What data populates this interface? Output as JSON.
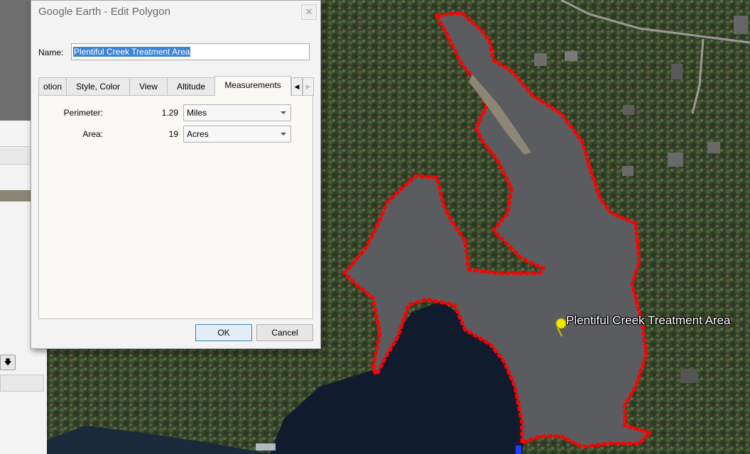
{
  "dialog": {
    "title": "Google Earth - Edit Polygon",
    "close_glyph": "✕",
    "name_label": "Name:",
    "name_value": "Plentiful Creek Treatment Area",
    "tabs": [
      {
        "label": "otion"
      },
      {
        "label": "Style, Color"
      },
      {
        "label": "View"
      },
      {
        "label": "Altitude"
      },
      {
        "label": "Measurements",
        "active": true
      }
    ],
    "tab_scroll_left": "◀",
    "tab_scroll_right": "▶",
    "measurements": {
      "perimeter_label": "Perimeter:",
      "perimeter_value": "1.29",
      "perimeter_unit": "Miles",
      "area_label": "Area:",
      "area_value": "19",
      "area_unit": "Acres"
    },
    "ok_label": "OK",
    "cancel_label": "Cancel"
  },
  "map": {
    "placemark_label": "Plentiful Creek Treatment Area",
    "polygon_color": "#ff0000",
    "water_color": "#5b5c60",
    "forest_color": "#3b4a2e",
    "placemark_color": "#f2e600"
  },
  "sidebar": {
    "down_arrow_glyph": "🡇"
  }
}
